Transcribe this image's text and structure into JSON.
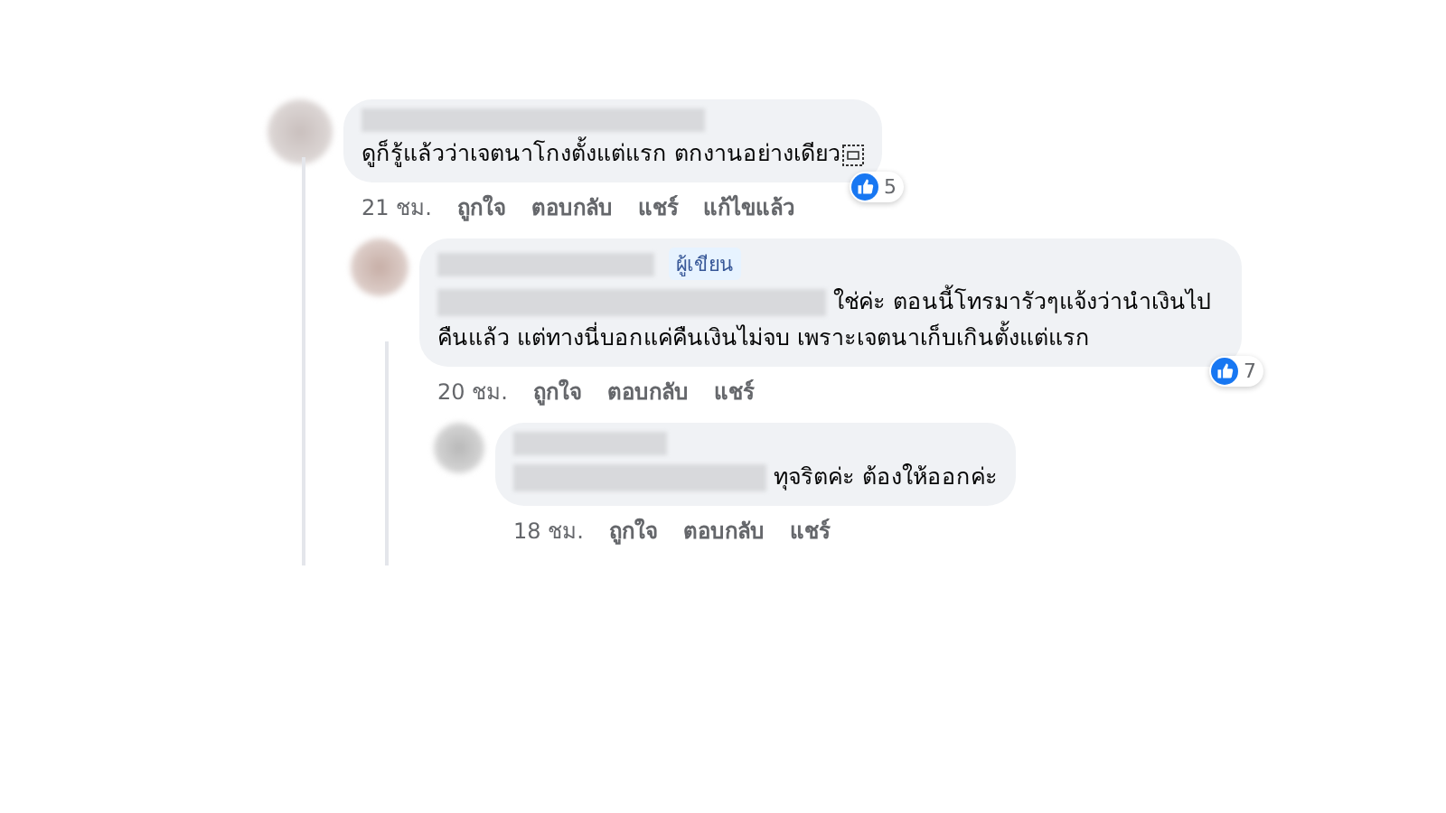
{
  "comments": [
    {
      "name_hidden": true,
      "mention_hidden": false,
      "object_icon": true,
      "text": "ดูก็รู้แล้วว่าเจตนาโกงตั้งแต่แรก ตกงานอย่างเดียว",
      "reactions": "5",
      "time": "21 ชม.",
      "actions": [
        "ถูกใจ",
        "ตอบกลับ",
        "แชร์",
        "แก้ไขแล้ว"
      ],
      "children": [
        {
          "name_hidden": true,
          "author_badge": "ผู้เขียน",
          "mention_hidden": true,
          "text": "ใช่ค่ะ ตอนนี้โทรมารัวๆแจ้งว่านำเงินไปคืนแล้ว แต่ทางนี่บอกแค่คืนเงินไม่จบ เพราะเจตนาเก็บเกินตั้งแต่แรก",
          "reactions": "7",
          "time": "20 ชม.",
          "actions": [
            "ถูกใจ",
            "ตอบกลับ",
            "แชร์"
          ],
          "children": [
            {
              "name_hidden": true,
              "mention_hidden": true,
              "text": "ทุจริตค่ะ ต้องให้ออกค่ะ",
              "time": "18 ชม.",
              "actions": [
                "ถูกใจ",
                "ตอบกลับ",
                "แชร์"
              ]
            }
          ]
        }
      ]
    }
  ]
}
